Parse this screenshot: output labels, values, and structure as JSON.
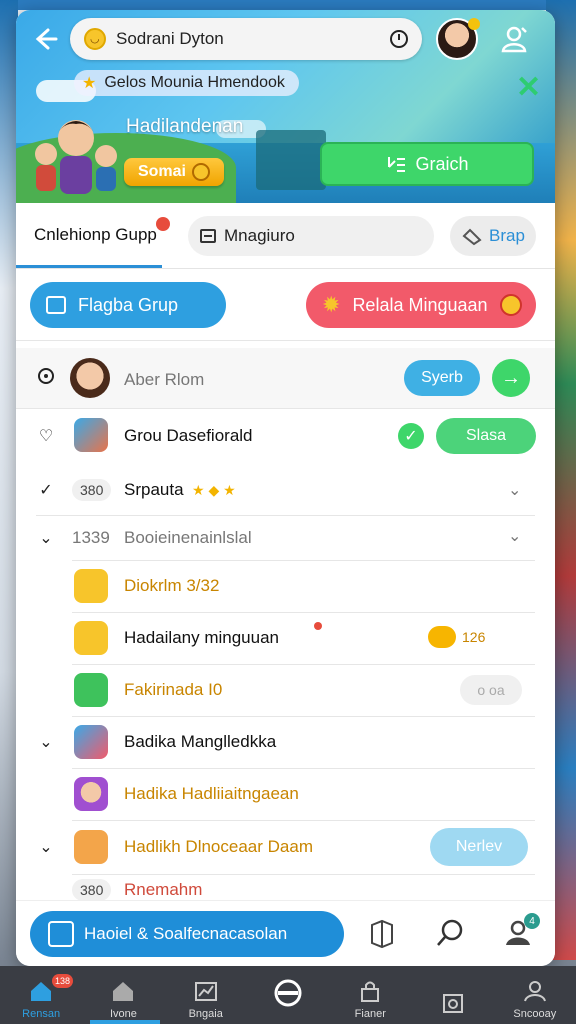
{
  "header": {
    "search_text": "Sodrani Dyton",
    "ribbon_text": "Gelos Mounia Hmendook",
    "hero_title": "Hadilandenan",
    "hero_subtitle": "",
    "soma_label": "Somai",
    "grab_label": "Graich"
  },
  "tabs": {
    "active_label": "Cnlehionp Gupp",
    "pill_label": "Mnagiuro",
    "brap_label": "Brap"
  },
  "actions": {
    "blue_pill": "Flagba Grup",
    "red_pill": "Relala Minguaan"
  },
  "rows": [
    {
      "text": "Aber Rlom",
      "button": "Syerb"
    },
    {
      "text": "Grou Dasefiorald",
      "button": "Slasa"
    },
    {
      "chip": "380",
      "text": "Srpauta"
    },
    {
      "chip": "1339",
      "text": "Booieinenainlslal"
    },
    {
      "text": "Diokrlm 3/32"
    },
    {
      "text": "Hadailany minguuan",
      "badge": "126"
    },
    {
      "text": "Fakirinada I0",
      "toggle": "o oa"
    },
    {
      "text": "Badika Manglledkka"
    },
    {
      "text": "Hadika Hadliiaitngaean"
    },
    {
      "text": "Hadlikh Dlnoceaar Daam",
      "button": "Nerlev"
    },
    {
      "chip": "380",
      "text": "Rnemahm"
    }
  ],
  "action_bar": {
    "primary_label": "Haoiel & Soalfecnacasolan",
    "badge": "4"
  },
  "nav": [
    {
      "label": "Rensan",
      "badge": "138"
    },
    {
      "label": "Ivone"
    },
    {
      "label": "Bngaia"
    },
    {
      "label": ""
    },
    {
      "label": "Fianer"
    },
    {
      "label": ""
    },
    {
      "label": "Sncooay"
    }
  ],
  "colors": {
    "accent_blue": "#2e9fe0",
    "accent_green": "#3ed66a",
    "accent_red": "#f25a6a",
    "gold_text": "#c88500"
  }
}
